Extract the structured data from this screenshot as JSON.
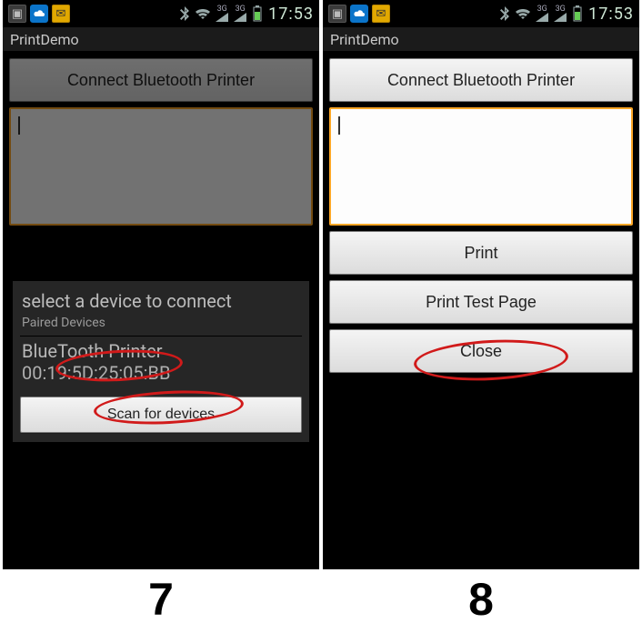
{
  "status": {
    "time": "17:53",
    "net_label_1": "3G",
    "net_label_2": "3G"
  },
  "app": {
    "title": "PrintDemo"
  },
  "buttons": {
    "connect": "Connect Bluetooth Printer",
    "print": "Print",
    "print_test": "Print Test Page",
    "close": "Close",
    "scan": "Scan for devices"
  },
  "dialog": {
    "title": "select a device to connect",
    "subtitle": "Paired Devices",
    "device_name": "BlueTooth Printer",
    "device_mac": "00:19:5D:25:05:BB"
  },
  "labels": {
    "left": "7",
    "right": "8"
  }
}
